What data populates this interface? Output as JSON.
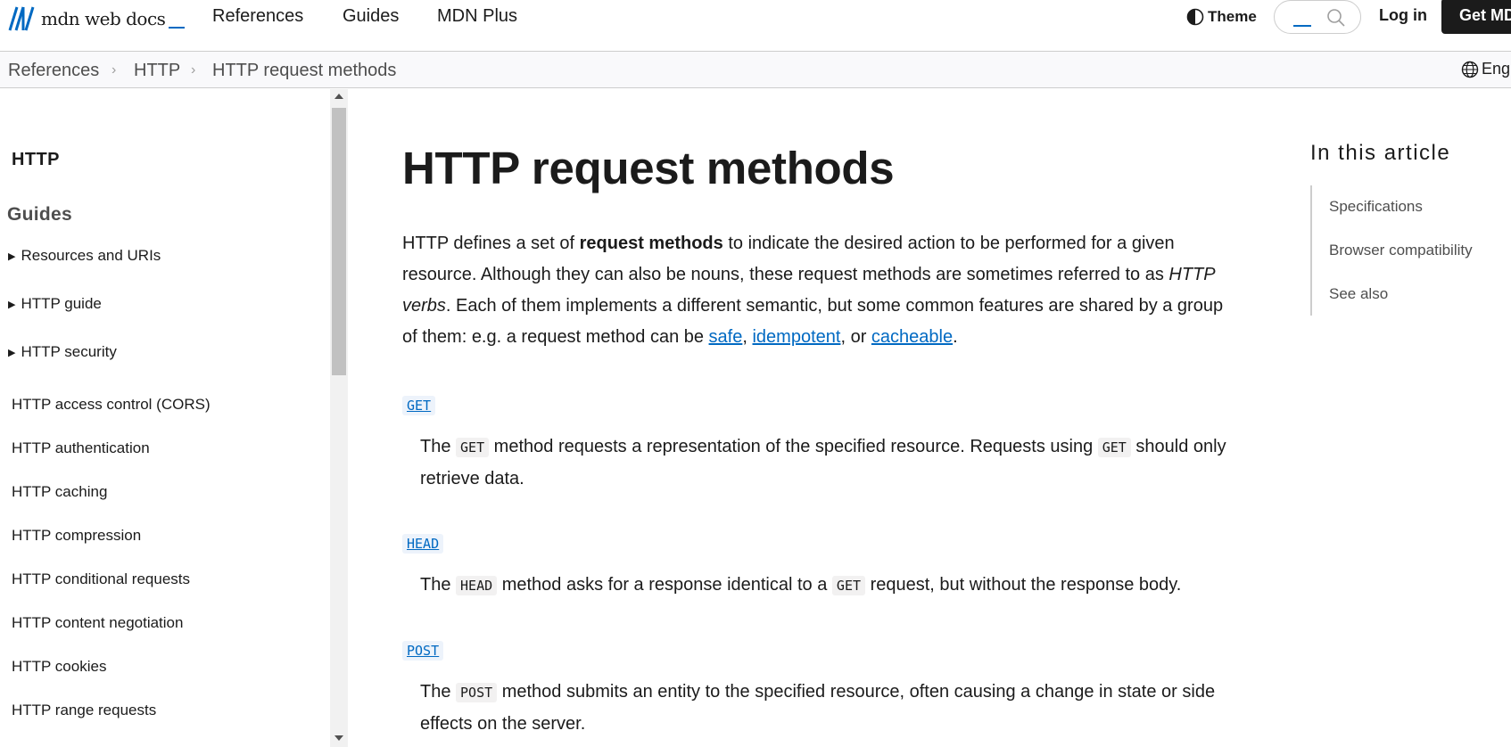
{
  "topnav": {
    "logo_text": "mdn web docs",
    "links": [
      "References",
      "Guides",
      "MDN Plus"
    ],
    "theme_label": "Theme",
    "login_label": "Log in",
    "cta_label": "Get MDN Plus"
  },
  "breadcrumb": {
    "items": [
      "References",
      "HTTP",
      "HTTP request methods"
    ],
    "language": "English (US)"
  },
  "sidebar": {
    "heading": "HTTP",
    "section": "Guides",
    "groups": [
      "Resources and URIs",
      "HTTP guide",
      "HTTP security"
    ],
    "links": [
      "HTTP access control (CORS)",
      "HTTP authentication",
      "HTTP caching",
      "HTTP compression",
      "HTTP conditional requests",
      "HTTP content negotiation",
      "HTTP cookies",
      "HTTP range requests"
    ]
  },
  "article": {
    "title": "HTTP request methods",
    "intro": {
      "p1": "HTTP defines a set of ",
      "bold": "request methods",
      "p2": " to indicate the desired action to be performed for a given resource. Although they can also be nouns, these request methods are sometimes referred to as ",
      "italic": "HTTP verbs",
      "p3": ". Each of them implements a different semantic, but some common features are shared by a group of them: e.g. a request method can be ",
      "link_safe": "safe",
      "sep1": ", ",
      "link_idempotent": "idempotent",
      "sep2": ", or ",
      "link_cacheable": "cacheable",
      "end": "."
    },
    "methods": [
      {
        "term": "GET",
        "desc": {
          "t1": "The ",
          "c1": "GET",
          "t2": " method requests a representation of the specified resource. Requests using ",
          "c2": "GET",
          "t3": " should only retrieve data."
        }
      },
      {
        "term": "HEAD",
        "desc": {
          "t1": "The ",
          "c1": "HEAD",
          "t2": " method asks for a response identical to a ",
          "c2": "GET",
          "t3": " request, but without the response body."
        }
      },
      {
        "term": "POST",
        "desc": {
          "t1": "The ",
          "c1": "POST",
          "t2": " method submits an entity to the specified resource, often causing a change in state or side effects on the server."
        }
      }
    ]
  },
  "toc": {
    "title": "In this article",
    "links": [
      "Specifications",
      "Browser compatibility",
      "See also"
    ]
  },
  "colors": {
    "link": "#0069c2",
    "text": "#1b1b1b",
    "muted": "#4e4e4e",
    "border": "#cdcdcd"
  },
  "icons": [
    "mdn-logo-icon",
    "theme-icon",
    "search-icon",
    "globe-icon",
    "chevron-right-icon",
    "triangle-right-icon"
  ]
}
